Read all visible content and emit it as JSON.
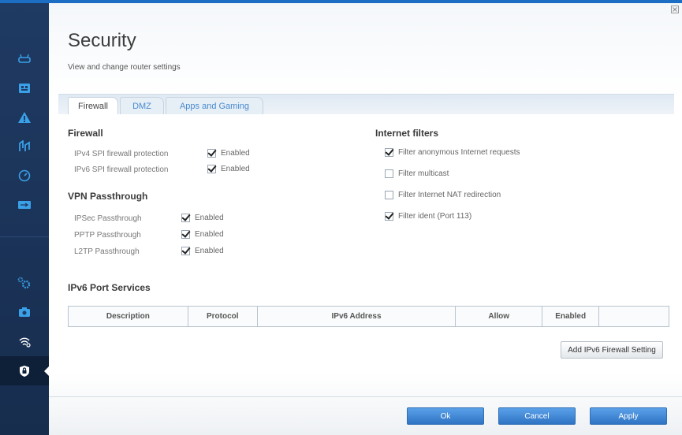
{
  "colors": {
    "accent": "#1c6ec4",
    "sidebar_bg": "#1f3a63",
    "tab_link": "#4a8bcf",
    "primary_button": "#2f74c4"
  },
  "sidebar": {
    "items": [
      {
        "icon": "router-icon"
      },
      {
        "icon": "device-list-icon"
      },
      {
        "icon": "troubleshooting-icon"
      },
      {
        "icon": "media-prioritization-icon"
      },
      {
        "icon": "speed-test-icon"
      },
      {
        "icon": "external-storage-icon"
      },
      {
        "icon": "connectivity-icon"
      },
      {
        "icon": "troubleshoot-camera-icon"
      },
      {
        "icon": "wireless-icon"
      },
      {
        "icon": "security-icon",
        "active": true
      }
    ]
  },
  "header": {
    "title": "Security",
    "subtitle": "View and change router settings"
  },
  "tabs": [
    {
      "label": "Firewall",
      "active": true
    },
    {
      "label": "DMZ",
      "active": false
    },
    {
      "label": "Apps and Gaming",
      "active": false
    }
  ],
  "firewall": {
    "heading": "Firewall",
    "rows": [
      {
        "label": "IPv4 SPI firewall protection",
        "checked": true,
        "value": "Enabled"
      },
      {
        "label": "IPv6 SPI firewall protection",
        "checked": true,
        "value": "Enabled"
      }
    ]
  },
  "vpn": {
    "heading": "VPN Passthrough",
    "rows": [
      {
        "label": "IPSec Passthrough",
        "checked": true,
        "value": "Enabled"
      },
      {
        "label": "PPTP Passthrough",
        "checked": true,
        "value": "Enabled"
      },
      {
        "label": "L2TP Passthrough",
        "checked": true,
        "value": "Enabled"
      }
    ]
  },
  "internet_filters": {
    "heading": "Internet filters",
    "rows": [
      {
        "label": "Filter anonymous Internet requests",
        "checked": true
      },
      {
        "label": "Filter multicast",
        "checked": false
      },
      {
        "label": "Filter Internet NAT redirection",
        "checked": false
      },
      {
        "label": "Filter ident (Port 113)",
        "checked": true
      }
    ]
  },
  "ipv6_ports": {
    "heading": "IPv6 Port Services",
    "columns": [
      "Description",
      "Protocol",
      "IPv6 Address",
      "Allow",
      "Enabled",
      ""
    ],
    "add_button": "Add IPv6 Firewall Setting"
  },
  "footer": {
    "ok": "Ok",
    "cancel": "Cancel",
    "apply": "Apply"
  }
}
